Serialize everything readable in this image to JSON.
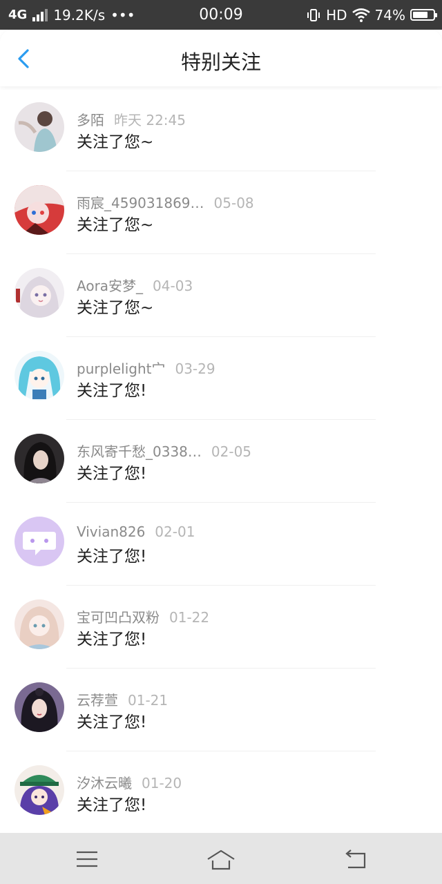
{
  "status_bar": {
    "network": "4G",
    "speed": "19.2K/s",
    "more": "•••",
    "time": "00:09",
    "hd": "HD",
    "battery": "74%",
    "battery_level": 0.74
  },
  "header": {
    "title": "特别关注",
    "back_icon": "chevron-left-icon",
    "accent": "#2a9cf0"
  },
  "items": [
    {
      "name": "多陌",
      "time": "昨天 22:45",
      "message": "关注了您~"
    },
    {
      "name": "雨宸_459031869…",
      "time": "05-08",
      "message": "关注了您~"
    },
    {
      "name": "Aora安梦_",
      "time": "04-03",
      "message": "关注了您~"
    },
    {
      "name": "purplelight宀",
      "time": "03-29",
      "message": "关注了您!"
    },
    {
      "name": "东风寄千愁_0338…",
      "time": "02-05",
      "message": "关注了您!"
    },
    {
      "name": "Vivian826",
      "time": "02-01",
      "message": "关注了您!"
    },
    {
      "name": "宝可凹凸双粉",
      "time": "01-22",
      "message": "关注了您!"
    },
    {
      "name": "云荐萱",
      "time": "01-21",
      "message": "关注了您!"
    },
    {
      "name": "汐沐云曦",
      "time": "01-20",
      "message": "关注了您!"
    }
  ],
  "navbar": {
    "menu_icon": "menu-icon",
    "home_icon": "home-icon",
    "back_icon": "back-icon"
  }
}
